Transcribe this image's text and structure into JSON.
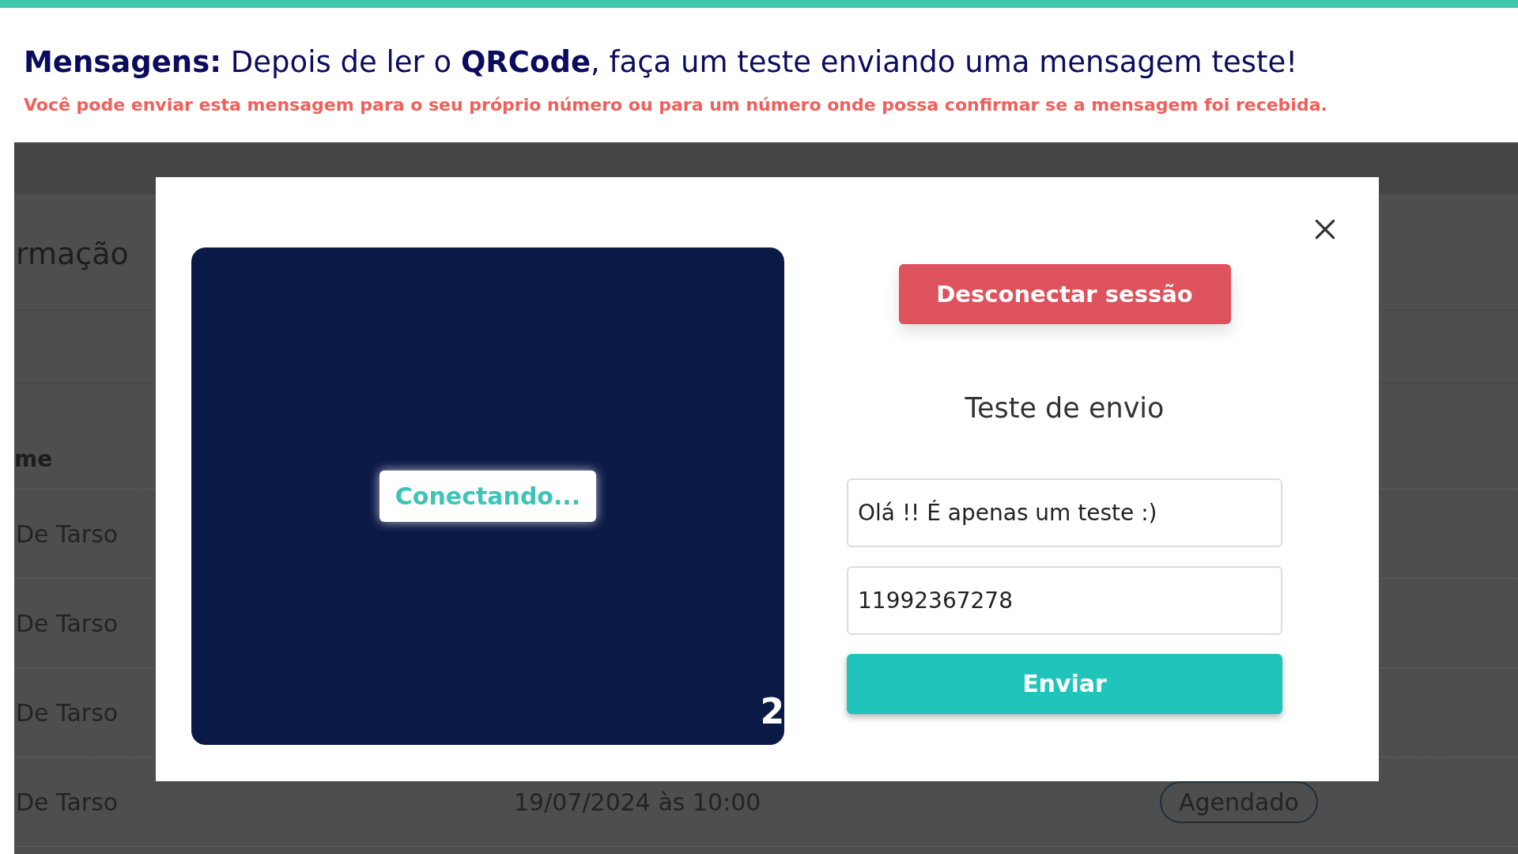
{
  "heading": {
    "text": "**Mensagens:** Depois de ler o **QRCode**, faça um teste enviando uma mensagem teste!",
    "note": "Você pode enviar esta mensagem para o seu próprio número ou para um número onde possa confirmar se a mensagem foi recebida."
  },
  "background": {
    "title": "rmação",
    "column_1": "me",
    "rows": [
      {
        "name": "De Tarso"
      },
      {
        "name": "De Tarso"
      },
      {
        "name": "De Tarso"
      },
      {
        "name": "De Tarso",
        "date": "19/07/2024 às 10:00",
        "status": "Agendado"
      }
    ]
  },
  "modal": {
    "status": "Conectando...",
    "corner_text": "2",
    "disconnect_button": "Desconectar sessão",
    "section_title": "Teste de envio",
    "message_field": {
      "value": "Olá !! É apenas um teste :)"
    },
    "phone_field": {
      "value": "11992367278"
    },
    "send_button": "Enviar"
  }
}
